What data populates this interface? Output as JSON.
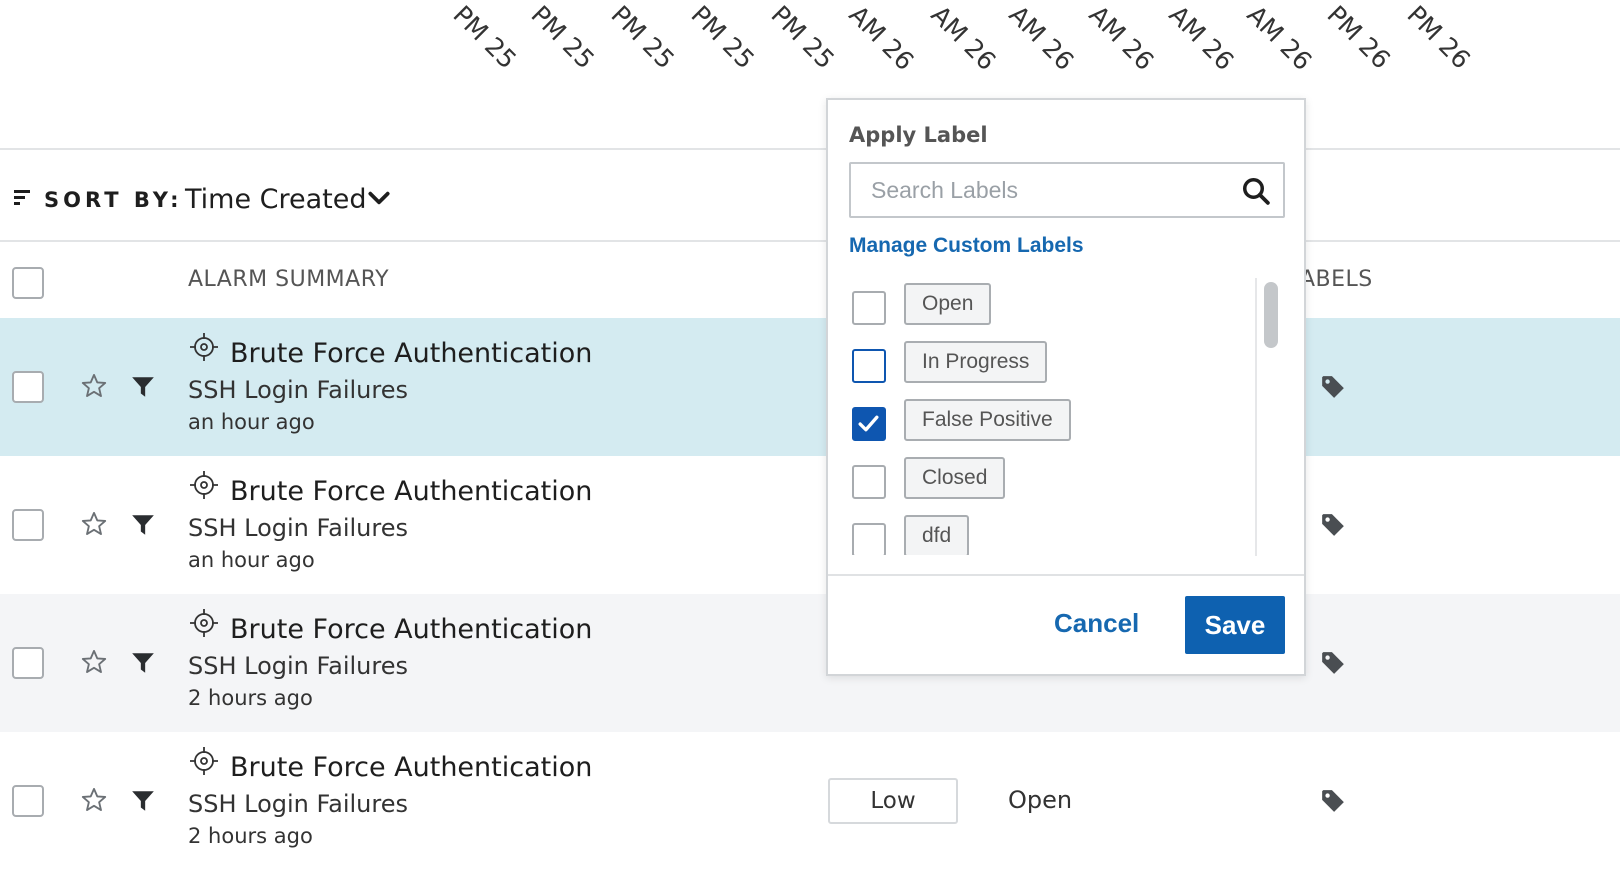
{
  "timeline": {
    "ticks": [
      "PM 25",
      "PM 25",
      "PM 25",
      "PM 25",
      "PM 25",
      "AM 26",
      "AM 26",
      "AM 26",
      "AM 26",
      "AM 26",
      "AM 26",
      "PM 26",
      "PM 26"
    ]
  },
  "sort": {
    "label": "SORT BY:",
    "value": "Time Created",
    "icon": "sort-lines-icon",
    "chevron": "chevron-down-icon"
  },
  "columns": {
    "summary": "ALARM SUMMARY",
    "labels": "ABELS"
  },
  "rows": [
    {
      "title": "Brute Force Authentication",
      "subtitle": "SSH Login Failures",
      "time": "an hour ago",
      "severity": "",
      "status": "",
      "highlight_color": "#d4ebf1"
    },
    {
      "title": "Brute Force Authentication",
      "subtitle": "SSH Login Failures",
      "time": "an hour ago",
      "severity": "",
      "status": "",
      "highlight_color": "#ffffff"
    },
    {
      "title": "Brute Force Authentication",
      "subtitle": "SSH Login Failures",
      "time": "2 hours ago",
      "severity": "",
      "status": "",
      "highlight_color": "#f4f5f7"
    },
    {
      "title": "Brute Force Authentication",
      "subtitle": "SSH Login Failures",
      "time": "2 hours ago",
      "severity": "Low",
      "status": "Open",
      "highlight_color": "#ffffff"
    }
  ],
  "apply_label": {
    "title": "Apply Label",
    "search_placeholder": "Search Labels",
    "manage_link": "Manage Custom Labels",
    "options": [
      {
        "label": "Open",
        "checked": false
      },
      {
        "label": "In Progress",
        "checked": false
      },
      {
        "label": "False Positive",
        "checked": true
      },
      {
        "label": "Closed",
        "checked": false
      },
      {
        "label": "dfd",
        "checked": false
      }
    ],
    "cancel": "Cancel",
    "save": "Save"
  },
  "colors": {
    "accent": "#0e61b0",
    "link": "#1668b0",
    "selected_row": "#d4ebf1",
    "alt_row": "#f4f5f7"
  }
}
